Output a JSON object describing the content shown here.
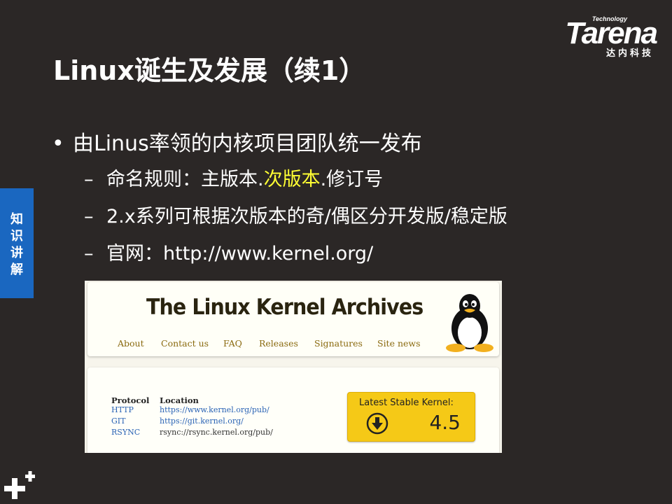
{
  "logo": {
    "small_text": "Technology",
    "wordmark": "Tarena",
    "chinese": "达内科技"
  },
  "slide": {
    "title": "Linux诞生及发展（续1）",
    "side_tab": [
      "知",
      "识",
      "讲",
      "解"
    ],
    "bullet": {
      "marker": "•",
      "text": "由Linus率领的内核项目团队统一发布"
    },
    "subs": [
      {
        "dash": "–",
        "before": "命名规则：主版本.",
        "highlight": "次版本",
        "after": ".修订号"
      },
      {
        "dash": "–",
        "text": "2.x系列可根据次版本的奇/偶区分开发版/稳定版"
      },
      {
        "dash": "–",
        "text": "官网：http://www.kernel.org/"
      }
    ],
    "highlight_color": "#ffff33"
  },
  "kernel_site": {
    "title": "The Linux Kernel Archives",
    "nav": [
      "About",
      "Contact us",
      "FAQ",
      "Releases",
      "Signatures",
      "Site news"
    ],
    "table": {
      "headers": [
        "Protocol",
        "Location"
      ],
      "rows": [
        {
          "protocol": "HTTP",
          "location": "https://www.kernel.org/pub/"
        },
        {
          "protocol": "GIT",
          "location": "https://git.kernel.org/"
        },
        {
          "protocol": "RSYNC",
          "location": "rsync://rsync.kernel.org/pub/"
        }
      ]
    },
    "latest": {
      "label": "Latest Stable Kernel:",
      "version": "4.5",
      "icon": "download-icon"
    },
    "mascot": "tux-penguin-icon"
  },
  "colors": {
    "background": "#2b2726",
    "side_tab": "#1a67c0",
    "kernel_box": "#f5c917",
    "link": "#2a63b5"
  }
}
